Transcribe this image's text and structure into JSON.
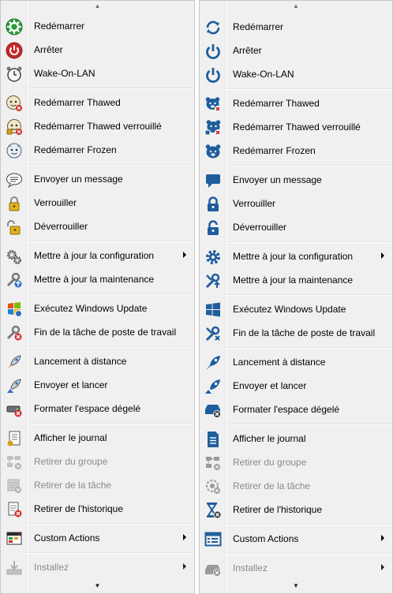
{
  "colors": {
    "blue_icon": "#1f5e9c",
    "disabled_icon": "#9a9a9a",
    "red": "#c62828",
    "green": "#2e9d3b",
    "gold": "#d4a017"
  },
  "left_menu": {
    "items": [
      {
        "label": "Redémarrer",
        "icon": "restart-green-icon"
      },
      {
        "label": "Arrêter",
        "icon": "power-red-icon"
      },
      {
        "label": "Wake-On-LAN",
        "icon": "alarm-clock-icon"
      },
      {
        "label": "Redémarrer Thawed",
        "icon": "thawed-face-icon"
      },
      {
        "label": "Redémarrer Thawed verrouillé",
        "icon": "thawed-locked-face-icon"
      },
      {
        "label": "Redémarrer Frozen",
        "icon": "frozen-face-icon"
      },
      {
        "label": "Envoyer un message",
        "icon": "speech-bubble-icon"
      },
      {
        "label": "Verrouiller",
        "icon": "lock-icon"
      },
      {
        "label": "Déverrouiller",
        "icon": "unlock-icon"
      },
      {
        "label": "Mettre à jour la configuration",
        "icon": "gears-icon",
        "submenu": true
      },
      {
        "label": "Mettre à jour la maintenance",
        "icon": "wrench-update-icon"
      },
      {
        "label": "Exécutez Windows Update",
        "icon": "windows-logo-icon"
      },
      {
        "label": "Fin de la tâche de poste de travail",
        "icon": "wrench-stop-icon"
      },
      {
        "label": "Lancement à distance",
        "icon": "rocket-icon"
      },
      {
        "label": "Envoyer et lancer",
        "icon": "rocket-send-icon"
      },
      {
        "label": "Formater l'espace dégelé",
        "icon": "drive-format-icon"
      },
      {
        "label": "Afficher le journal",
        "icon": "log-document-icon"
      },
      {
        "label": "Retirer du groupe",
        "icon": "group-remove-icon",
        "disabled": true
      },
      {
        "label": "Retirer de la tâche",
        "icon": "task-remove-icon",
        "disabled": true
      },
      {
        "label": "Retirer de l'historique",
        "icon": "history-remove-icon"
      },
      {
        "label": "Custom Actions",
        "icon": "custom-window-icon",
        "submenu": true
      },
      {
        "label": "Installez",
        "icon": "install-tray-icon",
        "submenu": true,
        "disabled": true
      }
    ]
  },
  "right_menu": {
    "items": [
      {
        "label": "Redémarrer",
        "icon": "restart-icon"
      },
      {
        "label": "Arrêter",
        "icon": "power-icon"
      },
      {
        "label": "Wake-On-LAN",
        "icon": "power-wake-icon"
      },
      {
        "label": "Redémarrer Thawed",
        "icon": "thawed-bear-icon"
      },
      {
        "label": "Redémarrer Thawed verrouillé",
        "icon": "thawed-locked-bear-icon"
      },
      {
        "label": "Redémarrer Frozen",
        "icon": "frozen-bear-icon"
      },
      {
        "label": "Envoyer un message",
        "icon": "message-icon"
      },
      {
        "label": "Verrouiller",
        "icon": "lock-icon"
      },
      {
        "label": "Déverrouiller",
        "icon": "unlock-icon"
      },
      {
        "label": "Mettre à jour la configuration",
        "icon": "gear-icon",
        "submenu": true
      },
      {
        "label": "Mettre à jour la maintenance",
        "icon": "tools-update-icon"
      },
      {
        "label": "Exécutez Windows Update",
        "icon": "windows-logo-icon"
      },
      {
        "label": "Fin de la tâche de poste de travail",
        "icon": "tools-stop-icon"
      },
      {
        "label": "Lancement à distance",
        "icon": "rocket-icon"
      },
      {
        "label": "Envoyer et lancer",
        "icon": "rocket-send-icon"
      },
      {
        "label": "Formater l'espace dégelé",
        "icon": "drive-format-icon"
      },
      {
        "label": "Afficher le journal",
        "icon": "document-icon"
      },
      {
        "label": "Retirer du groupe",
        "icon": "group-remove-icon",
        "disabled": true
      },
      {
        "label": "Retirer de la tâche",
        "icon": "task-remove-icon",
        "disabled": true
      },
      {
        "label": "Retirer de l'historique",
        "icon": "hourglass-remove-icon"
      },
      {
        "label": "Custom Actions",
        "icon": "app-window-icon",
        "submenu": true
      },
      {
        "label": "Installez",
        "icon": "install-icon",
        "submenu": true,
        "disabled": true
      }
    ]
  }
}
